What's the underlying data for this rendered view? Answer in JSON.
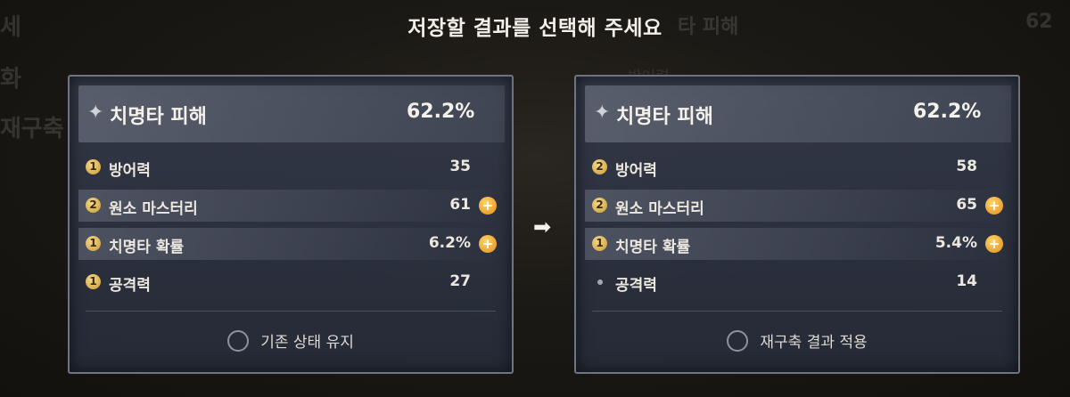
{
  "title": "저장할 결과를 선택해 주세요",
  "background_text": {
    "left_1": "세",
    "left_2": "화",
    "left_3": "재구축",
    "right_1": "타 피해",
    "right_2": "62",
    "right_3": "방어력"
  },
  "arrow_icon": "right-arrow-icon",
  "panels": [
    {
      "main": {
        "icon": "sparkle-star-icon",
        "name": "치명타 피해",
        "value": "62.2%"
      },
      "substats": [
        {
          "badge": "1",
          "name": "방어력",
          "value": "35",
          "plus": false,
          "highlight": false
        },
        {
          "badge": "2",
          "name": "원소 마스터리",
          "value": "61",
          "plus": true,
          "highlight": true
        },
        {
          "badge": "1",
          "name": "치명타 확률",
          "value": "6.2%",
          "plus": true,
          "highlight": true
        },
        {
          "badge": "1",
          "name": "공격력",
          "value": "27",
          "plus": false,
          "highlight": false
        }
      ],
      "option_label": "기존 상태 유지",
      "selected": false
    },
    {
      "main": {
        "icon": "sparkle-star-icon",
        "name": "치명타 피해",
        "value": "62.2%"
      },
      "substats": [
        {
          "badge": "2",
          "name": "방어력",
          "value": "58",
          "plus": false,
          "highlight": false
        },
        {
          "badge": "2",
          "name": "원소 마스터리",
          "value": "65",
          "plus": true,
          "highlight": true
        },
        {
          "badge": "1",
          "name": "치명타 확률",
          "value": "5.4%",
          "plus": true,
          "highlight": true
        },
        {
          "badge": "",
          "name": "공격력",
          "value": "14",
          "plus": false,
          "highlight": false
        }
      ],
      "option_label": "재구축 결과 적용",
      "selected": false
    }
  ],
  "colors": {
    "accent_gold": "#e08d19",
    "badge_gold": "#c99a35",
    "panel_border": "#6f7482"
  }
}
